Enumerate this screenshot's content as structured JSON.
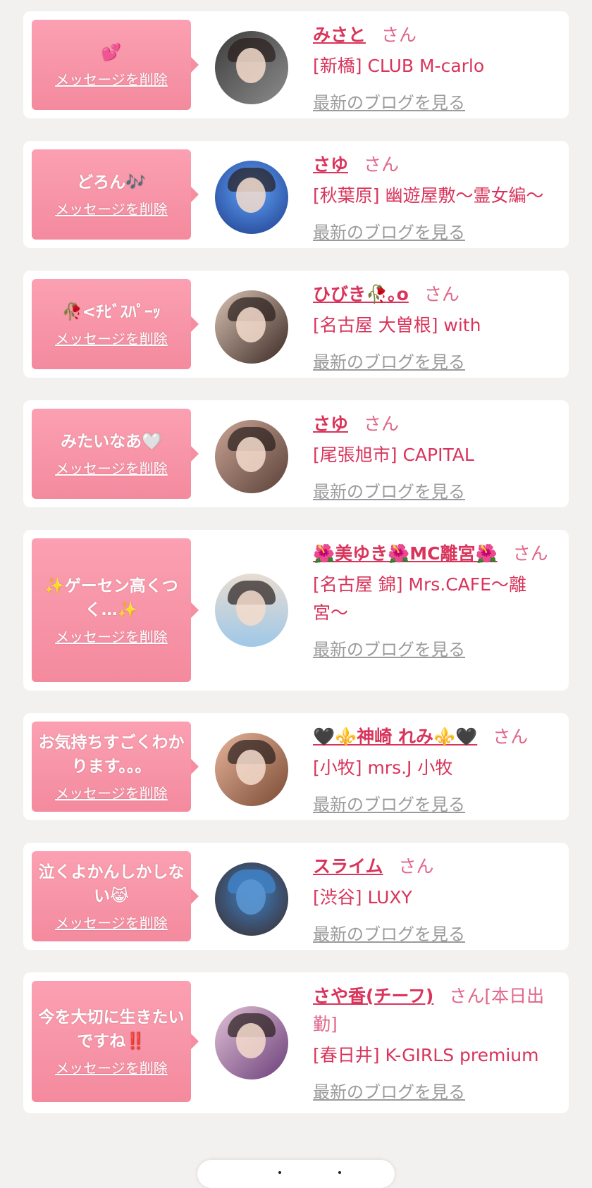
{
  "delete_label": "メッセージを削除",
  "san_label": "さん",
  "blog_label": "最新のブログを見る",
  "colors": {
    "background": "#f2f1f0",
    "card": "#ffffff",
    "bubble": "#f48a9e",
    "name": "#d9345b",
    "blog_link": "#9b9b9b"
  },
  "messages": [
    {
      "message": "💕",
      "name": "みさと",
      "shop": "[新橋] CLUB M-carlo",
      "avatar_palette": [
        "#3d3d3d",
        "#8c8c8c"
      ]
    },
    {
      "message": "どろん🎶",
      "name": "さゆ",
      "shop": "[秋葉原] 幽遊屋敷〜霊女編〜",
      "avatar_palette": [
        "#1e3a8a",
        "#60a5fa"
      ]
    },
    {
      "message": "🥀<ﾁﾋﾞｽﾊﾟｰｯ",
      "name": "ひびき🥀｡o",
      "shop": "[名古屋 大曽根] with",
      "avatar_palette": [
        "#d9c2b4",
        "#3b2a24"
      ]
    },
    {
      "message": "みたいなあ🤍",
      "name": "さゆ",
      "shop": "[尾張旭市] CAPITAL",
      "avatar_palette": [
        "#5a4038",
        "#c9a494"
      ]
    },
    {
      "message": "✨ゲーセン高くつく…✨",
      "name": "🌺美ゆき🌺MC離宮🌺",
      "shop": "[名古屋 錦] Mrs.CAFE〜離宮〜",
      "avatar_palette": [
        "#9fc8e8",
        "#e8dcd0"
      ]
    },
    {
      "message": "お気持ちすごくわかります。。。",
      "name": "🖤⚜️神崎 れみ⚜️🖤",
      "shop": "[小牧] mrs.J 小牧",
      "avatar_palette": [
        "#7a4a34",
        "#e6b49a"
      ]
    },
    {
      "message": "泣くよかんしかしない😹",
      "name": "スライム",
      "shop": "[渋谷] LUXY",
      "avatar_palette": [
        "#3a2a28",
        "#3f7fc2"
      ]
    },
    {
      "message": "今を大切に生きたいですね‼️",
      "name": "さや香(チーフ)",
      "name_suffix": "[本日出勤]",
      "shop": "[春日井] K-GIRLS premium",
      "avatar_palette": [
        "#6b3f7a",
        "#e1c2d6"
      ]
    }
  ]
}
